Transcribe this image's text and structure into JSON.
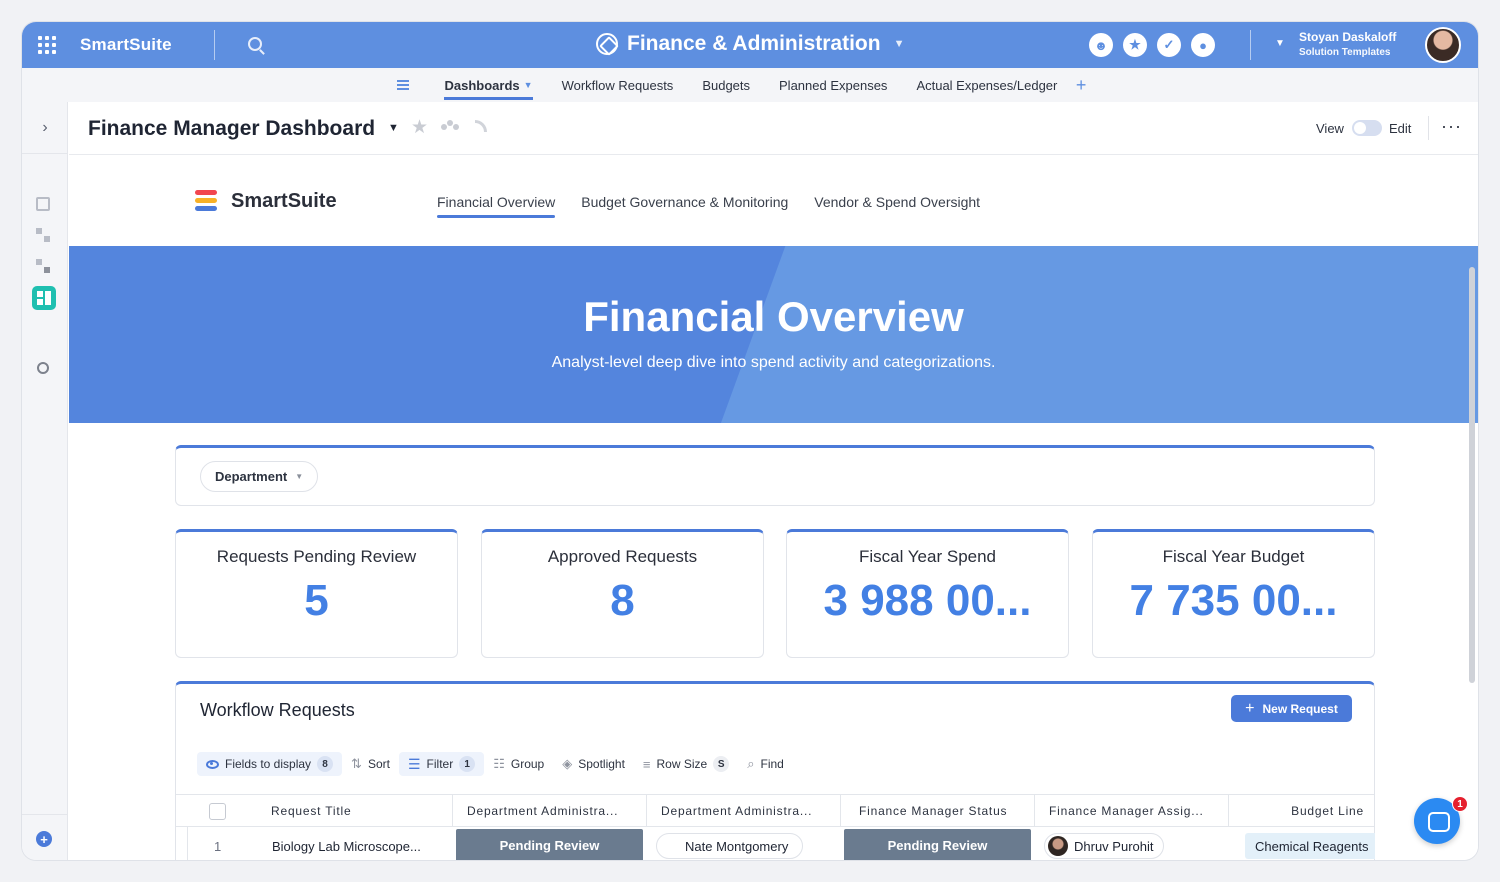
{
  "app": {
    "brand": "SmartSuite",
    "workspace": "Finance & Administration"
  },
  "user": {
    "name": "Stoyan Daskaloff",
    "role": "Solution Templates"
  },
  "subnav": {
    "tabs": [
      {
        "label": "Dashboards",
        "active": true
      },
      {
        "label": "Workflow Requests"
      },
      {
        "label": "Budgets"
      },
      {
        "label": "Planned Expenses"
      },
      {
        "label": "Actual Expenses/Ledger"
      }
    ],
    "add_symbol": "+"
  },
  "dashboard": {
    "title": "Finance Manager Dashboard",
    "view_label": "View",
    "edit_label": "Edit",
    "more_symbol": "···"
  },
  "canvas": {
    "logo_text": "SmartSuite",
    "logo_colors": [
      "#f2464f",
      "#f8b127",
      "#4b7ad9"
    ],
    "tabs": [
      "Financial Overview",
      "Budget Governance & Monitoring",
      "Vendor & Spend Oversight"
    ],
    "active_tab": "Financial Overview",
    "hero_title": "Financial Overview",
    "hero_subtitle": "Analyst-level deep dive into spend activity and categorizations.",
    "filter_label": "Department"
  },
  "metrics": [
    {
      "label": "Requests Pending Review",
      "value": "5"
    },
    {
      "label": "Approved Requests",
      "value": "8"
    },
    {
      "label": "Fiscal Year Spend",
      "value": "3 988 00..."
    },
    {
      "label": "Fiscal Year Budget",
      "value": "7 735 00..."
    }
  ],
  "workflow": {
    "title": "Workflow Requests",
    "new_button": "New Request",
    "toolbar": {
      "fields": "Fields to display",
      "fields_count": "8",
      "sort": "Sort",
      "filter": "Filter",
      "filter_count": "1",
      "group": "Group",
      "spotlight": "Spotlight",
      "row_size": "Row Size",
      "row_size_value": "S",
      "find": "Find"
    },
    "columns": [
      "Request Title",
      "Department Administra...",
      "Department Administra...",
      "Finance Manager Status",
      "Finance Manager Assig...",
      "Budget Line"
    ],
    "rows": [
      {
        "index": "1",
        "title": "Biology Lab Microscope...",
        "dept_status": "Pending Review",
        "dept_admin": "Nate Montgomery",
        "fm_status": "Pending Review",
        "fm_assignee": "Dhruv Purohit",
        "budget_line": "Chemical Reagents"
      }
    ]
  },
  "chat": {
    "badge": "1"
  },
  "colors": {
    "topbar": "#5e8fe0",
    "accent": "#4b7ad9",
    "metric": "#4380e4",
    "status_pill": "#6a7b8f",
    "hero": "#5485dd"
  }
}
